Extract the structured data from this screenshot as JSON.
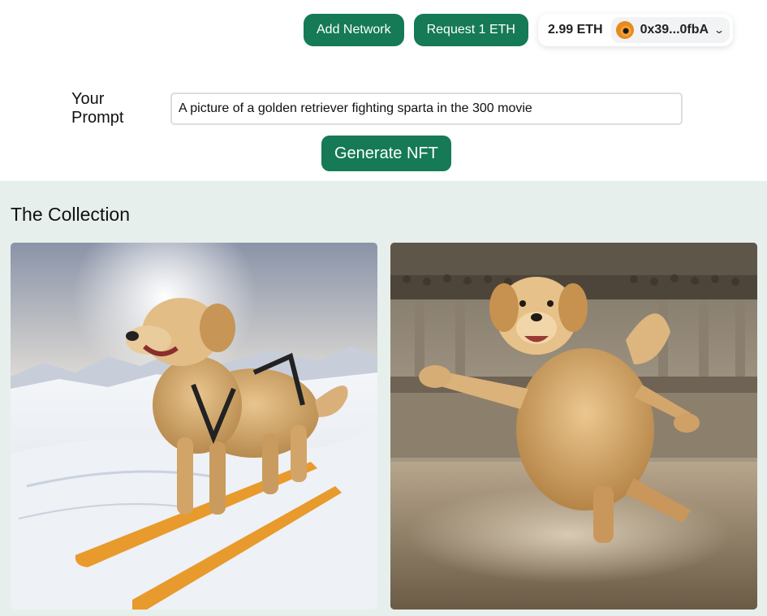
{
  "header": {
    "add_network_label": "Add Network",
    "request_eth_label": "Request 1 ETH",
    "wallet": {
      "balance": "2.99 ETH",
      "address": "0x39...0fbA",
      "chevron_icon": "chevron-down-icon"
    }
  },
  "prompt": {
    "label": "Your Prompt",
    "value": "A picture of a golden retriever fighting sparta in the 300 movie"
  },
  "generate_label": "Generate NFT",
  "collection": {
    "title": "The Collection"
  },
  "colors": {
    "primary_green": "#157a55",
    "collection_bg": "#e7efec"
  }
}
